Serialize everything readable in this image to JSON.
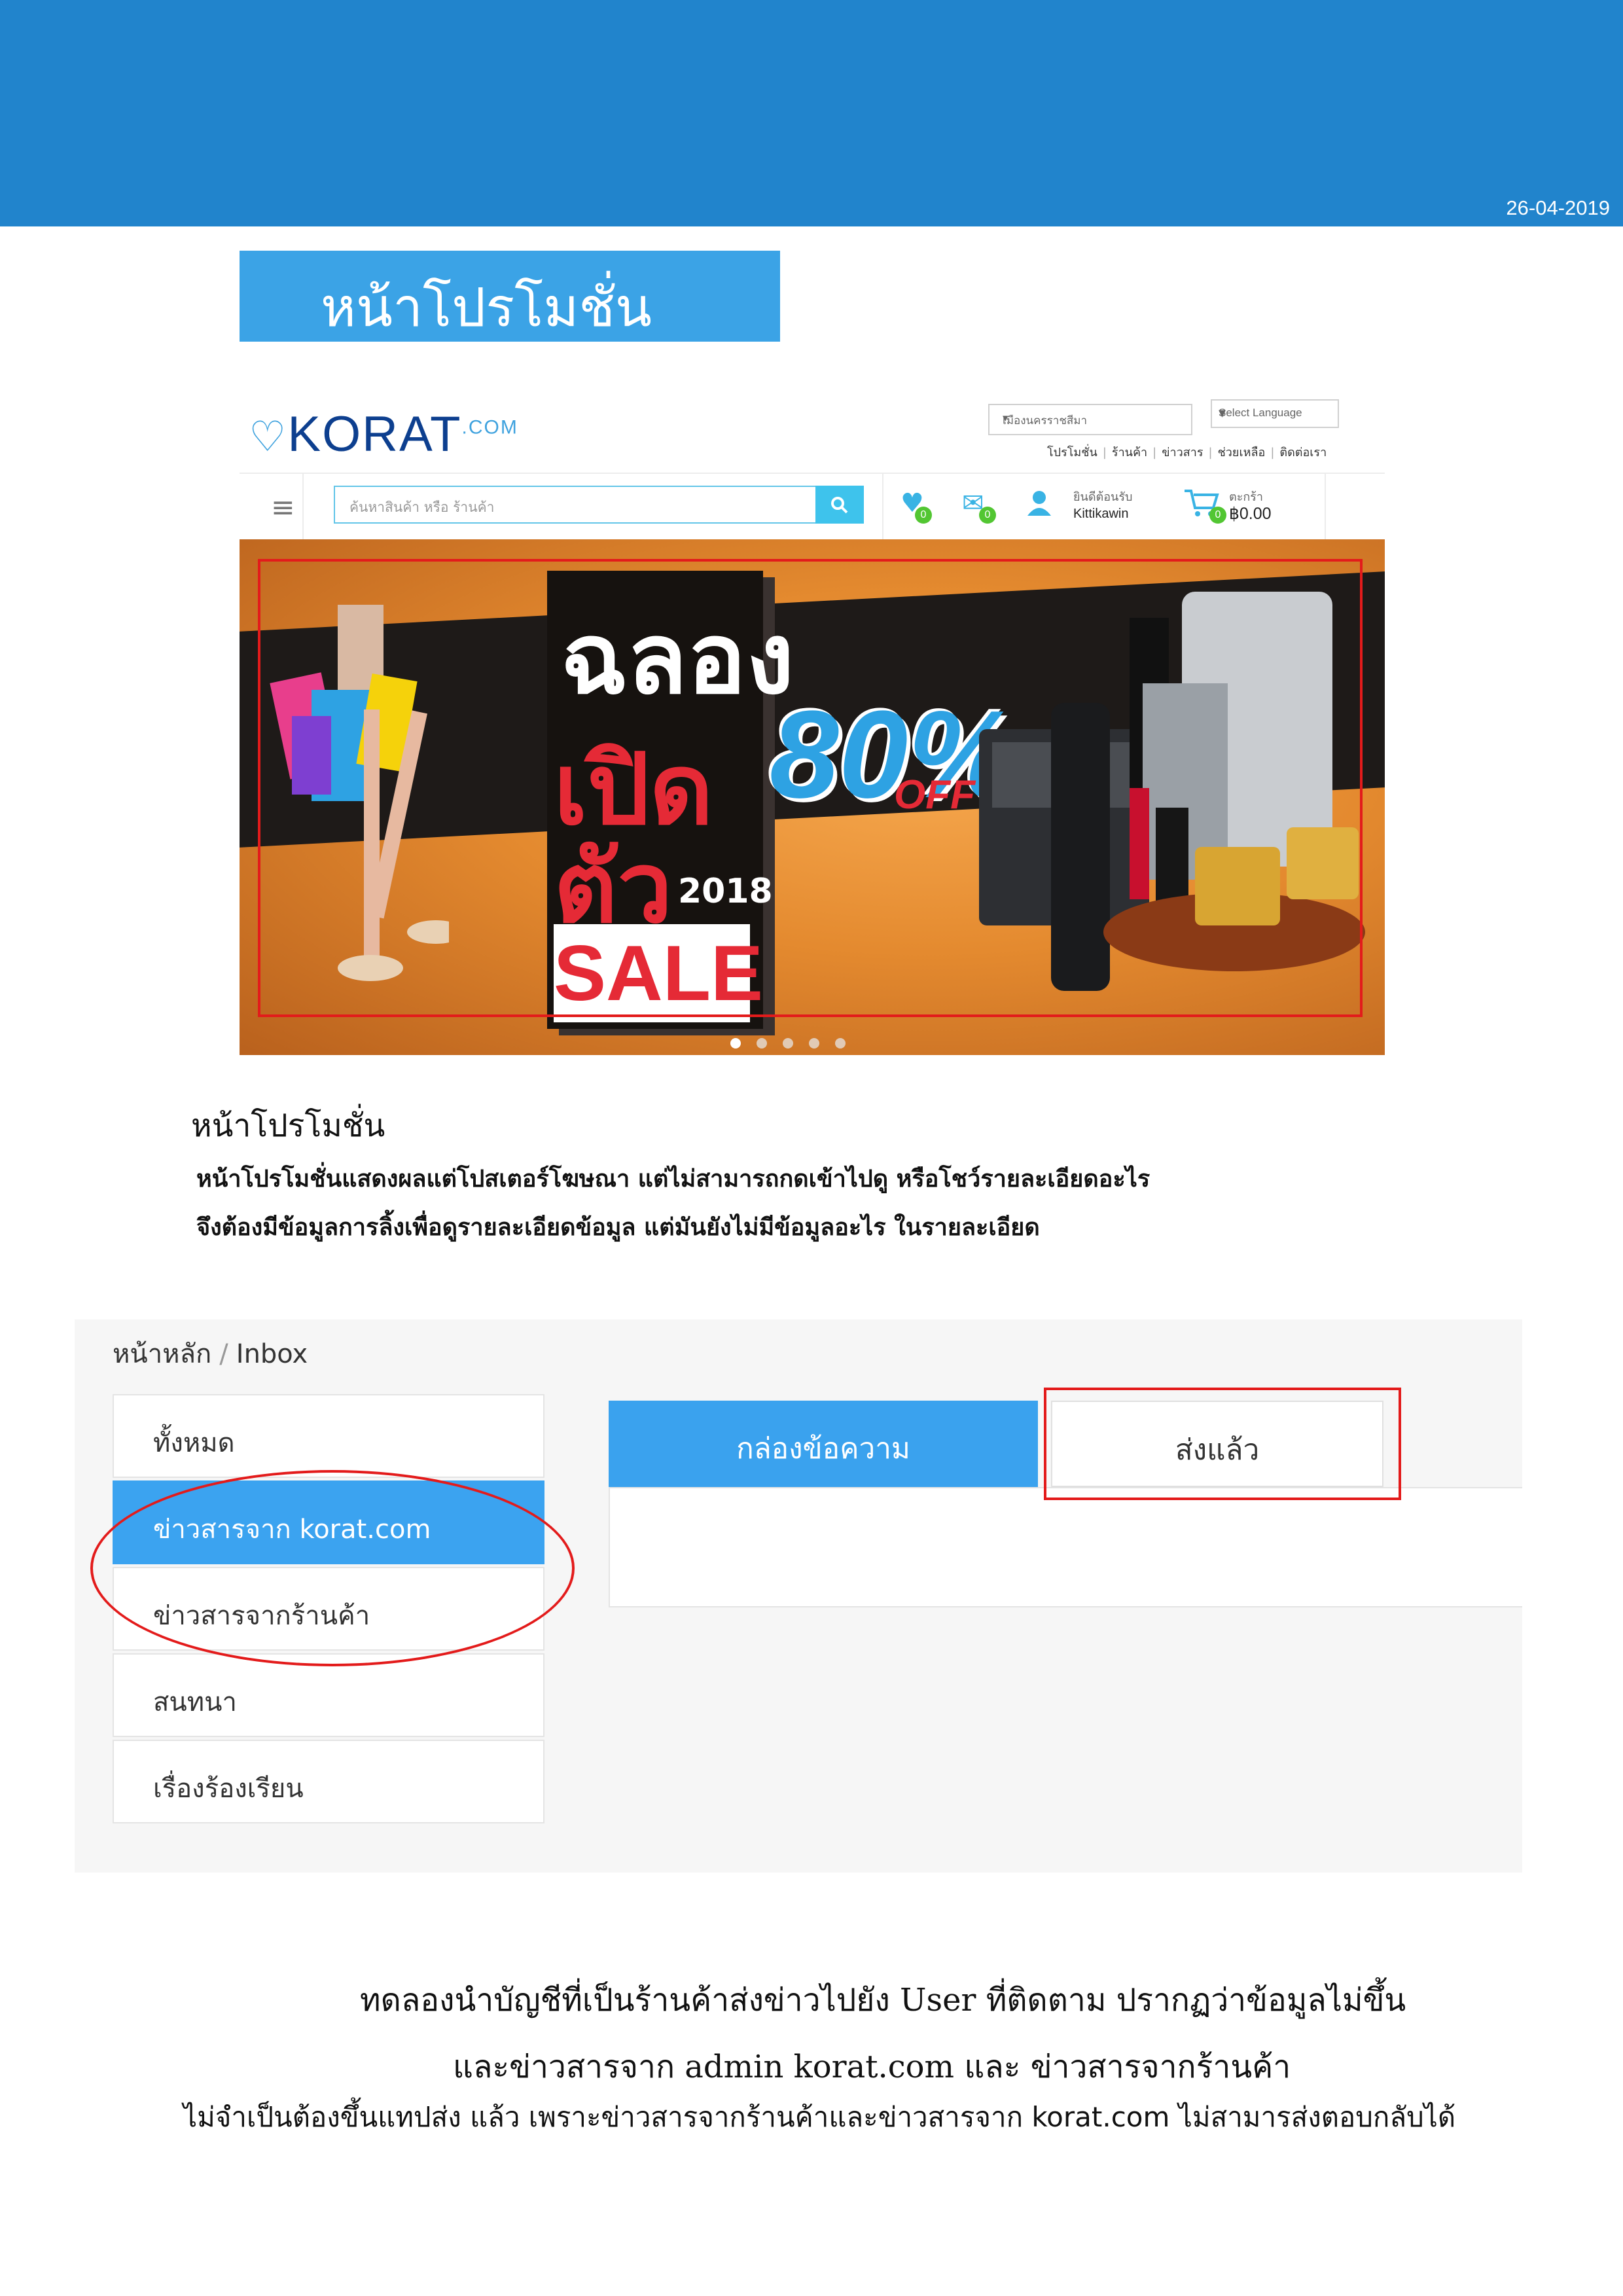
{
  "header": {
    "date": "26-04-2019"
  },
  "section_title": "หน้าโปรโมชั่น",
  "site": {
    "logo_text": "KORAT",
    "logo_suffix": ".COM",
    "province_select": "เมืองนครราชสีมา",
    "language_select": "Select Language",
    "top_links": [
      "โปรโมชั่น",
      "ร้านค้า",
      "ข่าวสาร",
      "ช่วยเหลือ",
      "ติดต่อเรา"
    ],
    "search_placeholder": "ค้นหาสินค้า หรือ ร้านค้า",
    "wishlist_count": "0",
    "message_count": "0",
    "user_welcome": "ยินดีต้อนรับ",
    "user_name": "Kittikawin",
    "cart_label": "ตะกร้า",
    "cart_count": "0",
    "cart_total": "฿0.00"
  },
  "promo": {
    "line1": "ฉลอง",
    "line2": "เปิดตัว",
    "year": "2018",
    "sale": "SALE",
    "percent": "80%",
    "off": "OFF",
    "slide_count": 5,
    "active_slide": 1
  },
  "caption": {
    "title": "หน้าโปรโมชั่น",
    "line1": "หน้าโปรโมชั่นแสดงผลแต่โปสเตอร์โฆษณา แต่ไม่สามารถกดเข้าไปดู หรือโชว์รายละเอียดอะไร",
    "line2": "จึงต้องมีข้อมูลการลิ้งเพื่อดูรายละเอียดข้อมูล แต่มันยังไม่มีข้อมูลอะไร ในรายละเอียด"
  },
  "inbox": {
    "breadcrumb_home": "หน้าหลัก",
    "breadcrumb_separator": "/",
    "breadcrumb_current": "Inbox",
    "sidebar": [
      {
        "label": "ทั้งหมด",
        "active": false
      },
      {
        "label": "ข่าวสารจาก korat.com",
        "active": true
      },
      {
        "label": "ข่าวสารจากร้านค้า",
        "active": false
      },
      {
        "label": "สนทนา",
        "active": false
      },
      {
        "label": "เรื่องร้องเรียน",
        "active": false
      }
    ],
    "tab_inbox": "กล่องข้อความ",
    "tab_sent": "ส่งแล้ว"
  },
  "notes": {
    "line1": "ทดลองนำบัญชีที่เป็นร้านค้าส่งข่าวไปยัง User ที่ติดตาม ปรากฏว่าข้อมูลไม่ขึ้น",
    "line2": "และข่าวสารจาก admin korat.com และ ข่าวสารจากร้านค้า",
    "line3": "ไม่จำเป็นต้องขึ้นแทปส่ง แล้ว เพราะข่าวสารจากร้านค้าและข่าวสารจาก korat.com ไม่สามารส่งตอบกลับได้"
  },
  "colors": {
    "header_blue": "#2184cc",
    "accent_blue": "#3ba3f0",
    "highlight_red": "#e31b1b",
    "badge_green": "#52c632"
  },
  "icons": [
    "menu-icon",
    "search-icon",
    "heart-icon",
    "mail-icon",
    "user-icon",
    "cart-icon"
  ]
}
